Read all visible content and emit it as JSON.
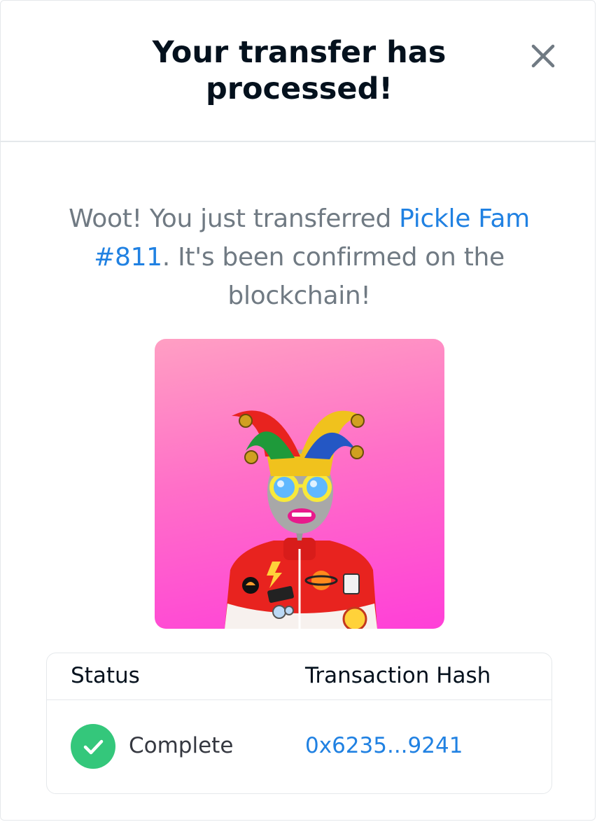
{
  "modal": {
    "title": "Your transfer has processed!",
    "close_icon": "close-icon"
  },
  "message": {
    "prefix": "Woot! You just transferred ",
    "item_name": "Pickle Fam #811",
    "suffix": ". It's been confirmed on the blockchain!"
  },
  "nft_image": {
    "description_icon": "nft-jester-avatar"
  },
  "table": {
    "headers": [
      "Status",
      "Transaction Hash"
    ],
    "row": {
      "status": "Complete",
      "status_icon": "check-icon",
      "hash": "0x6235...9241"
    }
  },
  "colors": {
    "title": "#04111d",
    "body_text": "#707a83",
    "link": "#2081e2",
    "success": "#34c77b",
    "border": "#e5e8eb"
  }
}
